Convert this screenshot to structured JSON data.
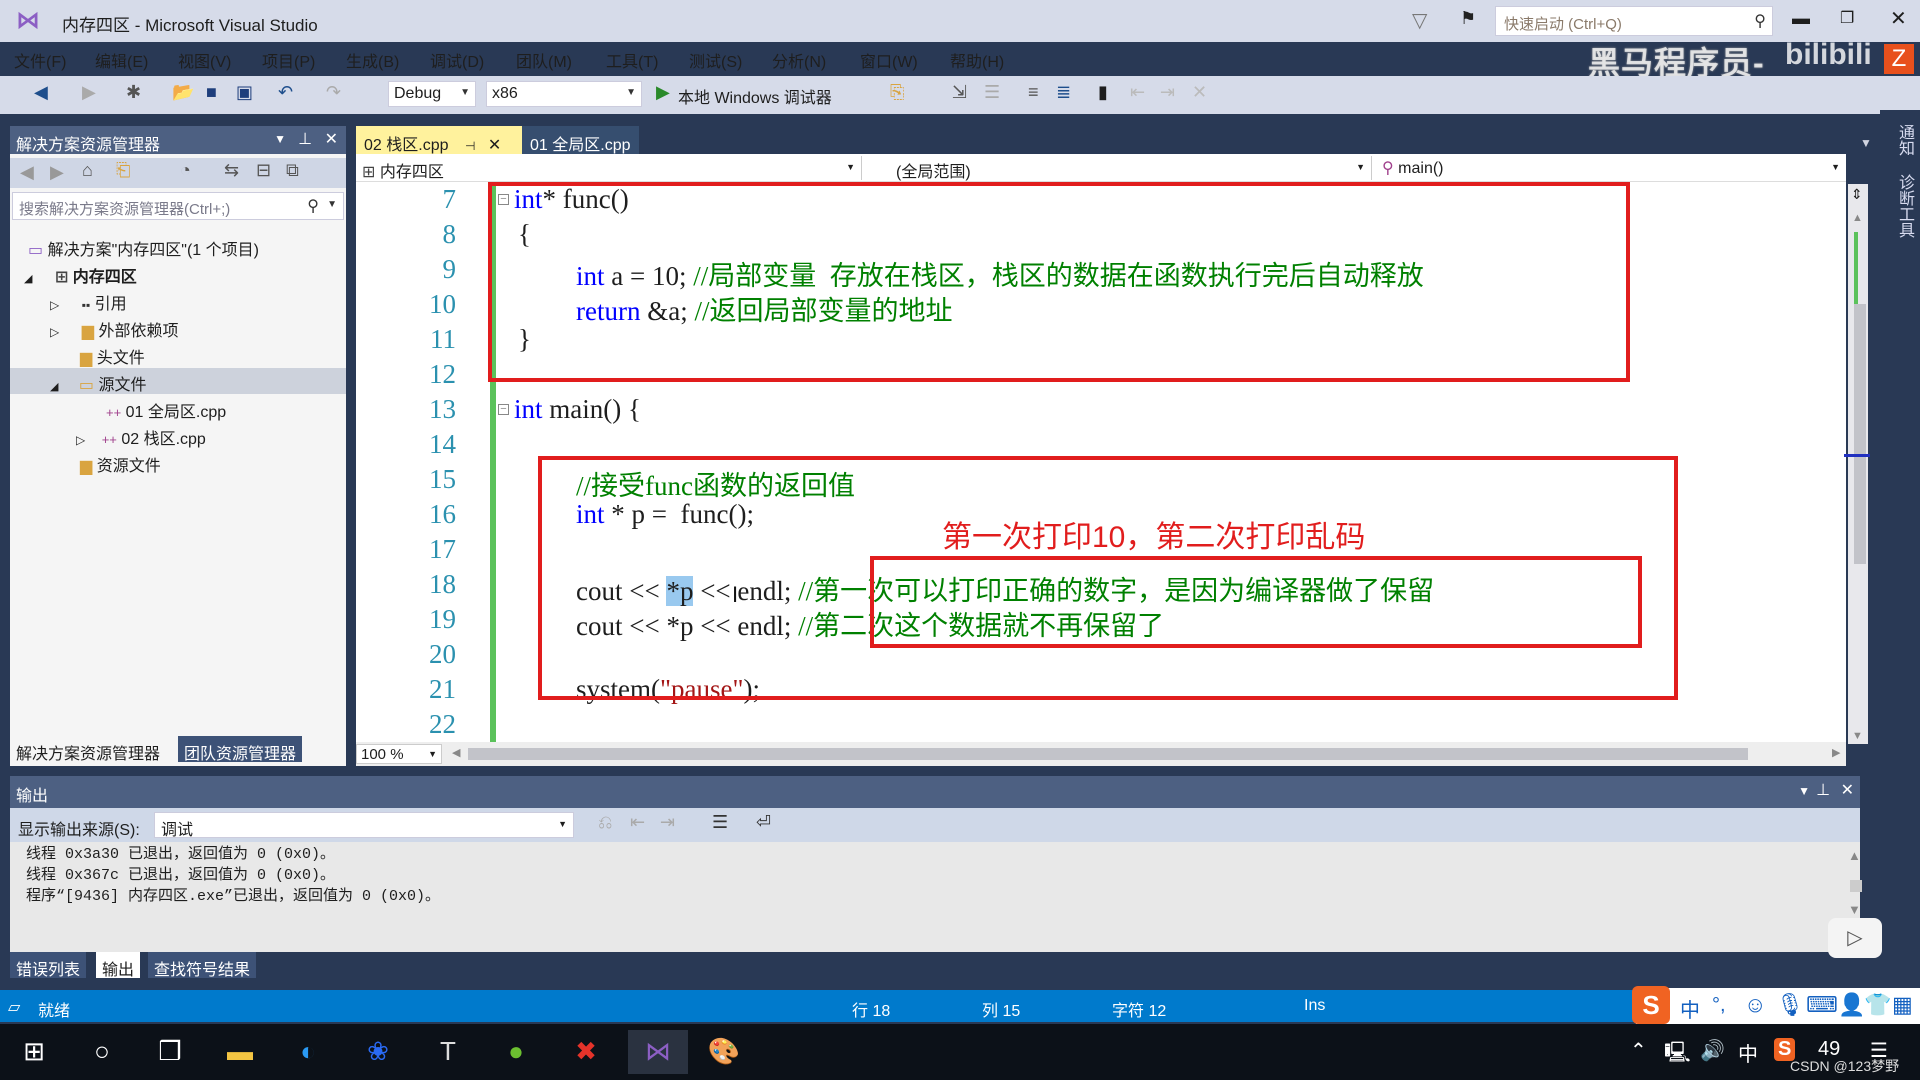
{
  "window": {
    "title": "内存四区 - Microsoft Visual Studio",
    "quick_launch_placeholder": "快速启动 (Ctrl+Q)",
    "watermark": "黑马程序员-",
    "bili": "bilibili",
    "badge": "Z"
  },
  "menu": [
    "文件(F)",
    "编辑(E)",
    "视图(V)",
    "项目(P)",
    "生成(B)",
    "调试(D)",
    "团队(M)",
    "工具(T)",
    "测试(S)",
    "分析(N)",
    "窗口(W)",
    "帮助(H)"
  ],
  "toolbar": {
    "config": "Debug",
    "platform": "x86",
    "run_label": "本地 Windows 调试器"
  },
  "solution_explorer": {
    "title": "解决方案资源管理器",
    "search_placeholder": "搜索解决方案资源管理器(Ctrl+;)",
    "tree": [
      {
        "label": "解决方案\"内存四区\"(1 个项目)",
        "level": 0
      },
      {
        "label": "内存四区",
        "level": 1,
        "expanded": true
      },
      {
        "label": "引用",
        "level": 2
      },
      {
        "label": "外部依赖项",
        "level": 2
      },
      {
        "label": "头文件",
        "level": 2
      },
      {
        "label": "源文件",
        "level": 2,
        "expanded": true,
        "selected": true
      },
      {
        "label": "01 全局区.cpp",
        "level": 3
      },
      {
        "label": "02 栈区.cpp",
        "level": 3
      },
      {
        "label": "资源文件",
        "level": 2
      }
    ],
    "bottom_tabs": [
      "解决方案资源管理器",
      "团队资源管理器"
    ]
  },
  "editor": {
    "tabs": [
      {
        "label": "02 栈区.cpp",
        "active": true
      },
      {
        "label": "01 全局区.cpp",
        "active": false
      }
    ],
    "nav": {
      "project": "内存四区",
      "scope": "(全局范围)",
      "member": "main()"
    },
    "zoom": "100 %",
    "lines": {
      "n7": "7",
      "n8": "8",
      "n9": "9",
      "n10": "10",
      "n11": "11",
      "n12": "12",
      "n13": "13",
      "n14": "14",
      "n15": "15",
      "n16": "16",
      "n17": "17",
      "n18": "18",
      "n19": "19",
      "n20": "20",
      "n21": "21",
      "n22": "22"
    },
    "code": {
      "l7_kw": "int",
      "l7_rest": "* func()",
      "l8": "{",
      "l9_kw": "int",
      "l9_rest": " a = 10; ",
      "l9_cm": "//局部变量  存放在栈区，栈区的数据在函数执行完后自动释放",
      "l10_kw": "return",
      "l10_rest": " &a; ",
      "l10_cm": "//返回局部变量的地址",
      "l11": "}",
      "l13_kw": "int",
      "l13_rest": " main() {",
      "l15_cm": "//接受func函数的返回值",
      "l16_kw": "int",
      "l16_rest": " * p =  func();",
      "l18_a": "cout << ",
      "l18_sel": "*p",
      "l18_b": " << endl; ",
      "l18_cm": "//第一次可以打印正确的数字，是因为编译器做了保留",
      "l19_a": "cout << *p << endl; ",
      "l19_cm": "//第二次这个数据就不再保留了",
      "l21_a": "system(",
      "l21_str": "\"pause\"",
      "l21_b": ");"
    },
    "annotation": "第一次打印10，第二次打印乱码"
  },
  "right_strip": [
    "通知",
    "诊断工具"
  ],
  "output": {
    "title": "输出",
    "source_label": "显示输出来源(S):",
    "source_value": "调试",
    "text": "线程 0x3a30 已退出，返回值为 0 (0x0)。\n线程 0x367c 已退出，返回值为 0 (0x0)。\n程序“[9436] 内存四区.exe”已退出，返回值为 0 (0x0)。",
    "tabs": [
      "错误列表",
      "输出",
      "查找符号结果"
    ]
  },
  "status": {
    "ready": "就绪",
    "line": "行 18",
    "col": "列 15",
    "char": "字符 12",
    "ins": "Ins"
  },
  "ime": {
    "lang": "中",
    "punct": "°,"
  },
  "taskbar": {
    "tray_lang": "中",
    "tray_num": "49",
    "credit": "CSDN @123梦野"
  }
}
